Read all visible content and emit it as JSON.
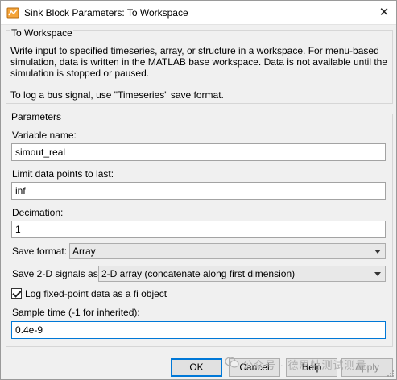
{
  "window": {
    "title": "Sink Block Parameters: To Workspace",
    "icon": "simulink-block-icon",
    "close": "close-icon"
  },
  "block": {
    "name": "To Workspace",
    "description": [
      "Write input to specified timeseries, array, or structure in a workspace. For menu-based",
      "simulation, data is written in the MATLAB base workspace. Data is not available until the",
      "simulation is stopped or paused."
    ],
    "note": "To log a bus signal, use \"Timeseries\" save format."
  },
  "parameters": {
    "heading": "Parameters",
    "variable_name": {
      "label": "Variable name:",
      "value": "simout_real"
    },
    "limit_data_points": {
      "label": "Limit data points to last:",
      "value": "inf"
    },
    "decimation": {
      "label": "Decimation:",
      "value": "1"
    },
    "save_format": {
      "label": "Save format:",
      "value": "Array"
    },
    "save_2d_signals": {
      "label": "Save 2-D signals as:",
      "value": "2-D array (concatenate along first dimension)"
    },
    "log_fixed_point": {
      "label": "Log fixed-point data as a fi object",
      "checked": true
    },
    "sample_time": {
      "label": "Sample time (-1 for inherited):",
      "value": "0.4e-9"
    }
  },
  "buttons": {
    "ok": "OK",
    "cancel": "Cancel",
    "help": "Help",
    "apply": "Apply"
  },
  "watermark": {
    "text": "公众号 · 德思特测试测量",
    "icon": "wechat-icon"
  },
  "colors": {
    "focus_border": "#0078d7",
    "dialog_bg": "#f0f0f0"
  }
}
